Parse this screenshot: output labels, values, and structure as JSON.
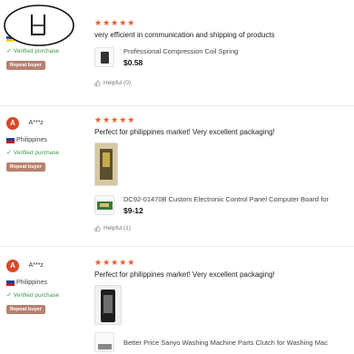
{
  "reviews": [
    {
      "user": {
        "initial": "",
        "name": "",
        "country": "",
        "verified": "Verified purchase",
        "badge": "Repeat buyer"
      },
      "stars": "★★★★★",
      "text": "very efficient in communication and shipping of products",
      "product": {
        "name": "Professional Compression Coil Spring",
        "price": "$0.58"
      },
      "helpful": "Helpful (0)"
    },
    {
      "user": {
        "initial": "A",
        "name": "A***z",
        "country": "Philippines",
        "verified": "Verified purchase",
        "badge": "Repeat buyer"
      },
      "stars": "★★★★★",
      "text": "Perfect for philippines market! Very excellent packaging!",
      "product": {
        "name": "DC92-01470B Custom Electronic Control Panel Computer Board for",
        "price": "$9-12"
      },
      "helpful": "Helpful (1)"
    },
    {
      "user": {
        "initial": "A",
        "name": "A***z",
        "country": "Philippines",
        "verified": "Verified purchase",
        "badge": "Repeat buyer"
      },
      "stars": "★★★★★",
      "text": "Perfect for philippines market! Very excellent packaging!",
      "product": {
        "name": "Better Price Sanyo Washing Machine Parts Clutch for Washing Mac",
        "price": ""
      },
      "helpful": ""
    }
  ]
}
